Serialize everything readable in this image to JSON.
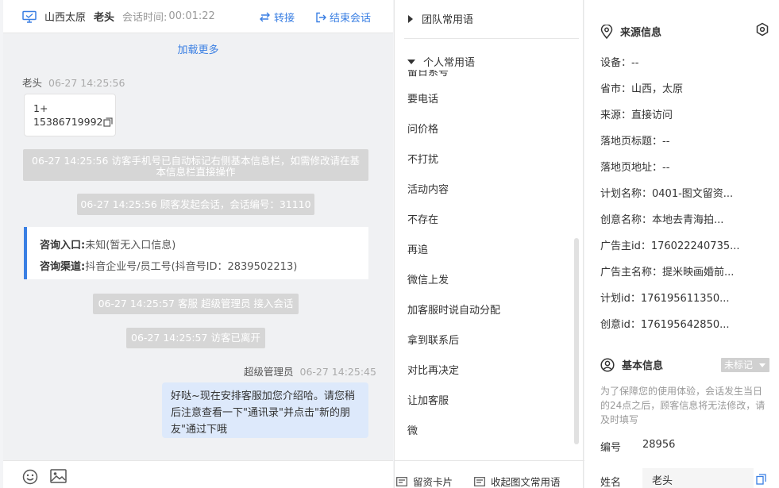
{
  "header": {
    "region": "山西太原",
    "name": "老头",
    "time_label": "会话时间:",
    "time": "00:01:22",
    "transfer": "转接",
    "end": "结束会话"
  },
  "chat": {
    "load_more": "加载更多",
    "msg1": {
      "sender": "老头",
      "time": "06-27 14:25:56",
      "line1": "1+",
      "phone": "15386719992"
    },
    "sys1": "06-27 14:25:56 访客手机号已自动标记右侧基本信息栏，如需修改请在基本信息栏直接操作",
    "sys2": "06-27 14:25:56 顾客发起会话，会话编号：31110",
    "consult": {
      "entry_label": "咨询入口:",
      "entry_value": "未知(暂无入口信息)",
      "channel_label": "咨询渠道:",
      "channel_value": "抖音企业号/员工号(抖音号ID：2839502213)"
    },
    "sys3": "06-27 14:25:57 客服 超级管理员 接入会话",
    "sys4": "06-27 14:25:57 访客已离开",
    "msg2": {
      "sender": "超级管理员",
      "time": "06-27 14:25:45",
      "text": "好哒~现在安排客服加您介绍哈。请您稍后注意查看一下\"通讯录\"并点击\"新的朋友\"通过下哦"
    }
  },
  "phrases": {
    "team_group": "团队常用语",
    "personal_group": "个人常用语",
    "items": [
      "要电话",
      "问价格",
      "不打扰",
      "活动内容",
      "不存在",
      "再追",
      "微信上发",
      "加客服时说自动分配",
      "拿到联系后",
      "对比再决定",
      "让加客服",
      "微"
    ],
    "clipped_item": "留日系号",
    "footer": {
      "card": "留资卡片",
      "collapse": "收起图文常用语"
    }
  },
  "info": {
    "source_title": "来源信息",
    "source_rows": [
      "设备：--",
      "省市：山西，太原",
      "来源：直接访问",
      "落地页标题：--",
      "落地页地址：--",
      "计划名称：0401-图文留资...",
      "创意名称：本地去青海拍...",
      "广告主id：176022240735...",
      "广告主名称：提米映画婚前...",
      "计划id：176195611350...",
      "创意id：176195642850..."
    ],
    "basic_title": "基本信息",
    "tag": "未标记",
    "hint": "为了保障您的使用体验，会话发生当日的24点之后，顾客信息将无法修改，请及时填写",
    "id_label": "编号",
    "id_value": "28956",
    "name_label": "姓名",
    "name_value": "老头"
  }
}
